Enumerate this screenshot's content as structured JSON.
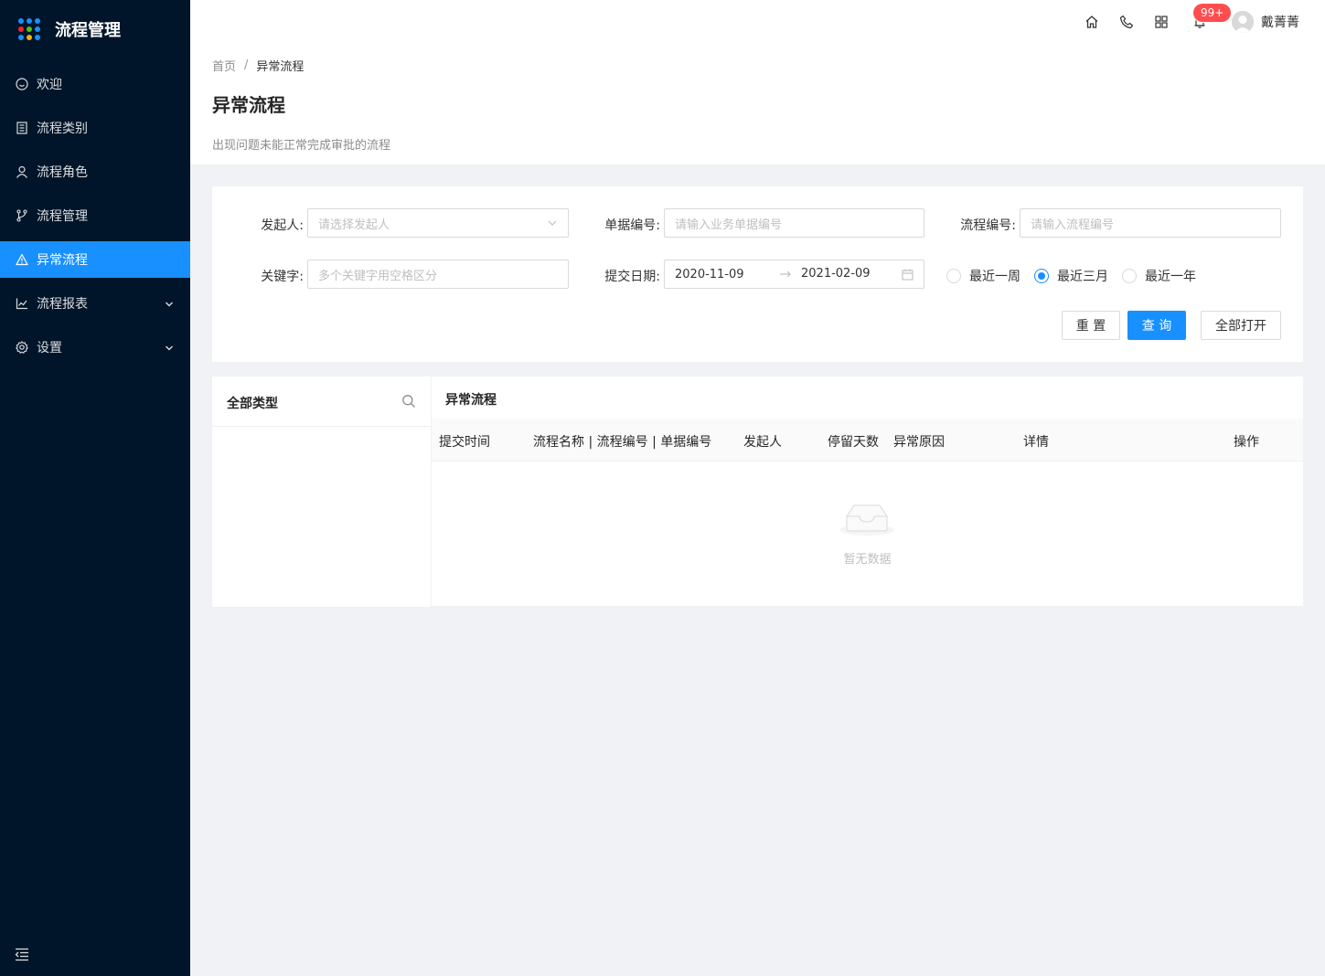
{
  "app": {
    "title": "流程管理",
    "logo_colors": [
      "#1890ff",
      "#1890ff",
      "#1890ff",
      "#f5222d",
      "#52c41a",
      "#1890ff",
      "#1890ff",
      "#faad14",
      "#1890ff"
    ]
  },
  "sidebar": {
    "items": [
      {
        "label": "欢迎",
        "icon": "smile-icon",
        "active": false
      },
      {
        "label": "流程类别",
        "icon": "book-icon",
        "active": false
      },
      {
        "label": "流程角色",
        "icon": "user-icon",
        "active": false
      },
      {
        "label": "流程管理",
        "icon": "branch-icon",
        "active": false
      },
      {
        "label": "异常流程",
        "icon": "warning-icon",
        "active": true
      },
      {
        "label": "流程报表",
        "icon": "line-chart-icon",
        "active": false,
        "expandable": true
      },
      {
        "label": "设置",
        "icon": "gear-icon",
        "active": false,
        "expandable": true
      }
    ],
    "accent": "#1890ff",
    "background": "#001529"
  },
  "header": {
    "icons": [
      "home-icon",
      "phone-icon",
      "apps-icon",
      "bell-icon"
    ],
    "badge": "99+",
    "username": "戴菁菁"
  },
  "page": {
    "breadcrumb": [
      "首页",
      "异常流程"
    ],
    "title": "异常流程",
    "description": "出现问题未能正常完成审批的流程"
  },
  "filters": {
    "initiator": {
      "label": "发起人:",
      "placeholder": "请选择发起人"
    },
    "doc_no": {
      "label": "单据编号:",
      "placeholder": "请输入业务单据编号"
    },
    "flow_no": {
      "label": "流程编号:",
      "placeholder": "请输入流程编号"
    },
    "keyword": {
      "label": "关键字:",
      "placeholder": "多个关键字用空格区分"
    },
    "date": {
      "label": "提交日期:",
      "start": "2020-11-09",
      "end": "2021-02-09"
    },
    "ranges": [
      {
        "label": "最近一周",
        "checked": false
      },
      {
        "label": "最近三月",
        "checked": true
      },
      {
        "label": "最近一年",
        "checked": false
      }
    ],
    "buttons": {
      "reset": "重 置",
      "query": "查 询",
      "open_all": "全部打开"
    }
  },
  "types_panel": {
    "title": "全部类型"
  },
  "table": {
    "title": "异常流程",
    "columns": [
      "提交时间",
      "流程名称 | 流程编号 | 单据编号",
      "发起人",
      "停留天数",
      "异常原因",
      "详情",
      "操作"
    ],
    "empty_text": "暂无数据"
  }
}
